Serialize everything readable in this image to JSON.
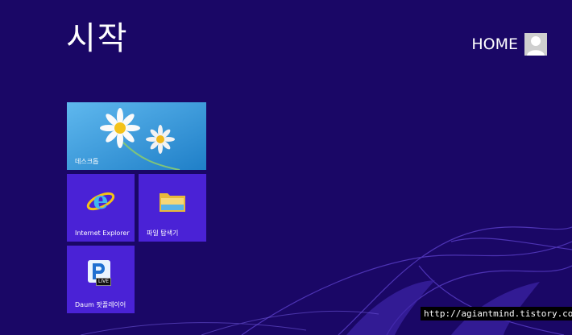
{
  "start_screen": {
    "title": "시작",
    "user": {
      "name": "HOME",
      "avatar_icon": "user-avatar-icon"
    }
  },
  "tiles": [
    {
      "label": "데스크톱",
      "icon": "daisy-wallpaper"
    },
    {
      "label": "Internet Explorer",
      "icon": "internet-explorer-icon"
    },
    {
      "label": "파일 탐색기",
      "icon": "folder-icon"
    },
    {
      "label": "Daum 팟플레이어",
      "icon": "potplayer-live-icon",
      "badge": "LIVE"
    }
  ],
  "watermark": {
    "text": "http://agiantmind.tistory.com"
  },
  "colors": {
    "background": "#1a0766",
    "tile": "#4a22d6",
    "desktop_tile_sky": "#3fa0dc"
  }
}
